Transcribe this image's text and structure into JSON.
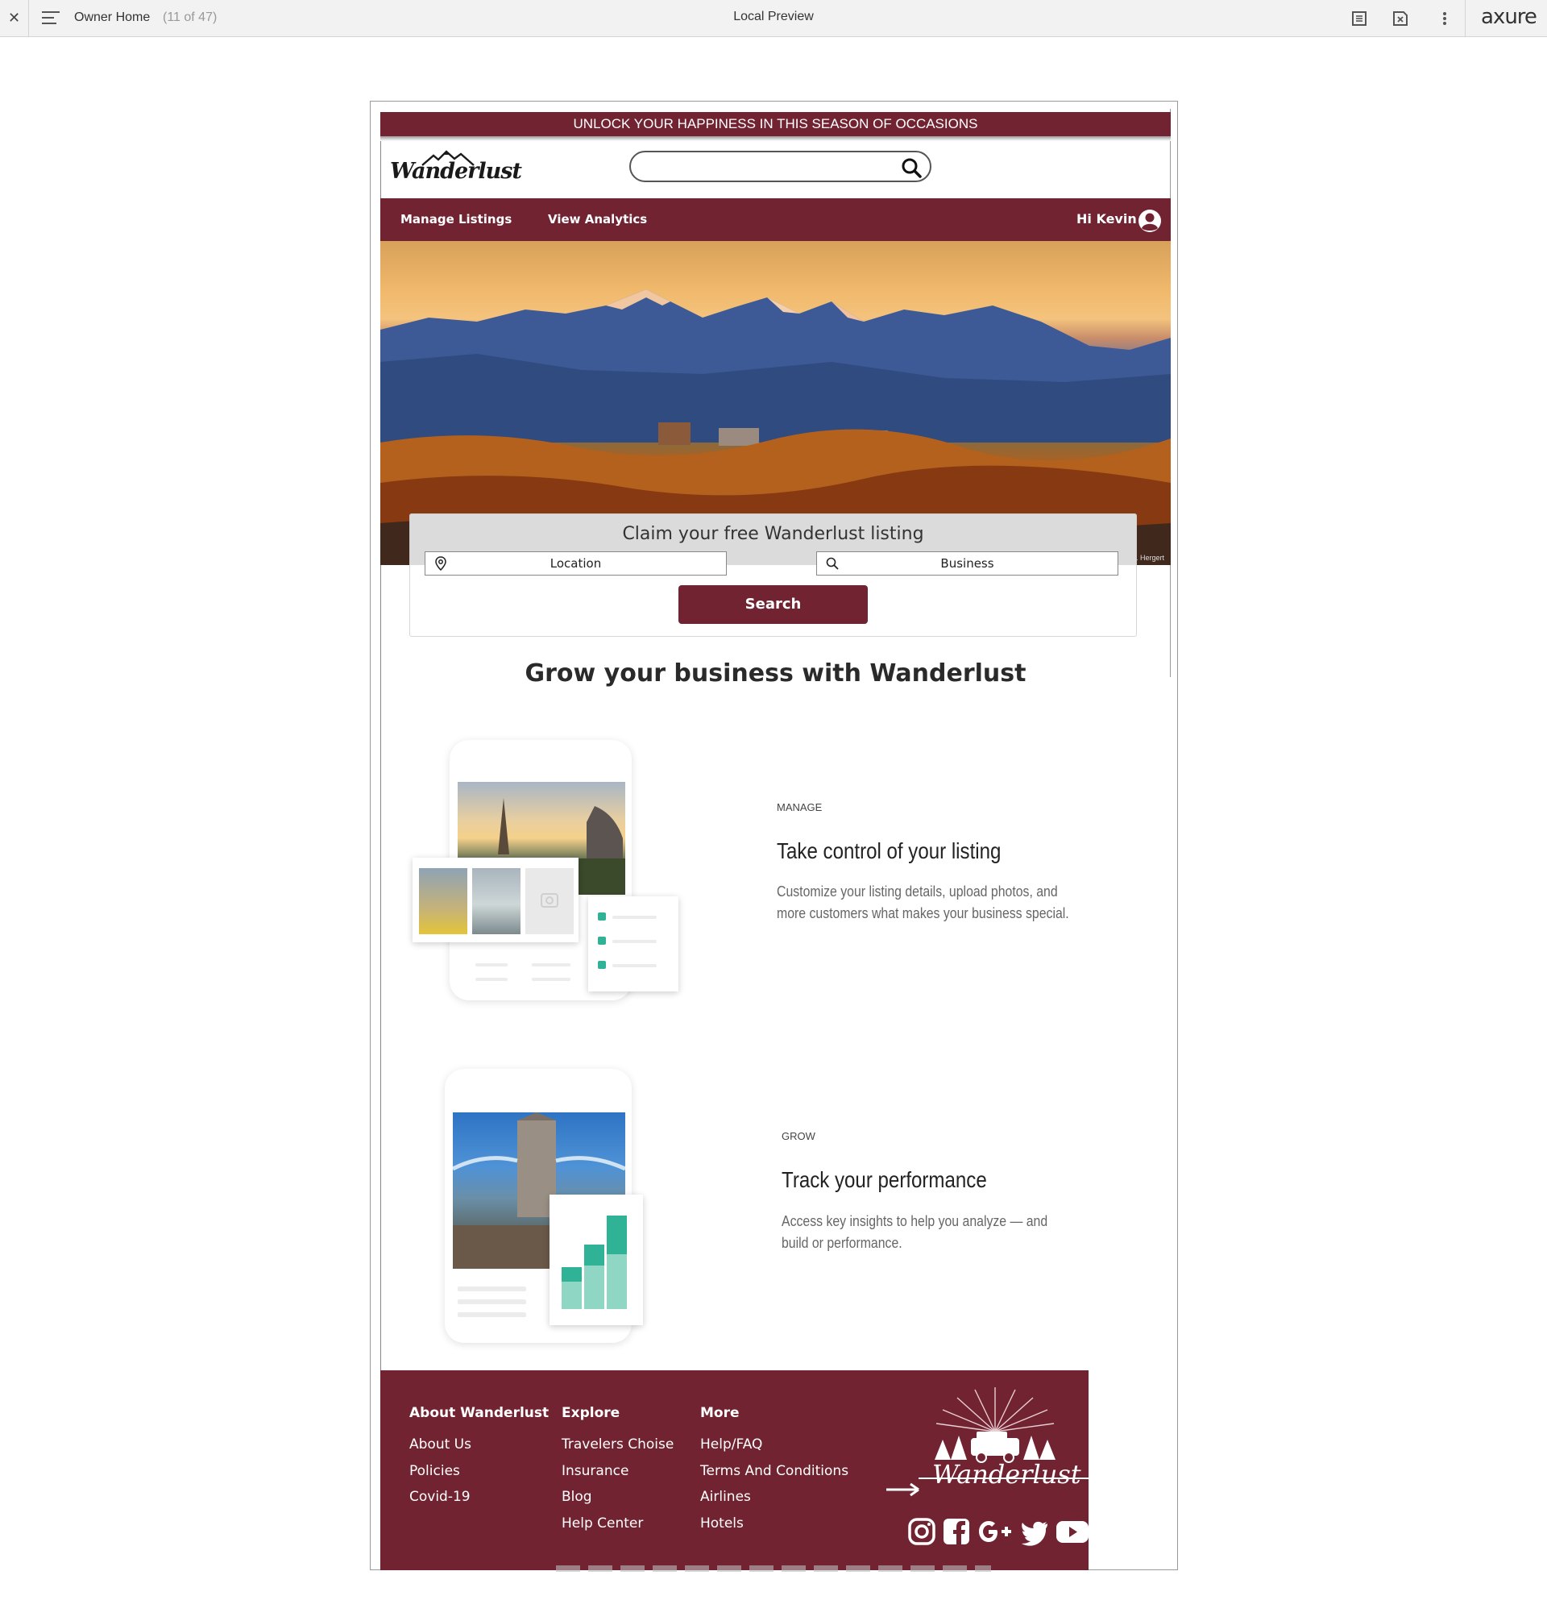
{
  "viewer": {
    "page_name": "Owner Home",
    "page_count": "(11 of 47)",
    "title": "Local Preview",
    "brand": "axure"
  },
  "site": {
    "banner": "UNLOCK YOUR HAPPINESS IN THIS SEASON OF OCCASIONS",
    "logo_text": "Wanderlust",
    "search": {
      "placeholder": "",
      "value": ""
    },
    "nav": {
      "manage_listings": "Manage Listings",
      "view_analytics": "View Analytics",
      "greeting": "Hi Kevin"
    },
    "hero": {
      "credit": "W. Hergert"
    },
    "claim": {
      "title": "Claim your free Wanderlust listing",
      "location_label": "Location",
      "business_label": "Business",
      "search_button": "Search"
    },
    "grow_heading": "Grow your business with Wanderlust",
    "features": [
      {
        "kicker": "MANAGE",
        "title": "Take control of your listing",
        "description": "Customize your listing details, upload photos, and more customers what makes your business special."
      },
      {
        "kicker": "GROW",
        "title": "Track your performance",
        "description": "Access key insights to help you analyze — and build or performance."
      }
    ],
    "footer": {
      "columns": [
        {
          "heading": "About Wanderlust",
          "links": [
            "About Us",
            "Policies",
            "Covid-19"
          ]
        },
        {
          "heading": "Explore",
          "links": [
            "Travelers Choise",
            "Insurance",
            "Blog",
            "Help Center"
          ]
        },
        {
          "heading": "More",
          "links": [
            "Help/FAQ",
            "Terms And Conditions",
            "Airlines",
            "Hotels"
          ]
        }
      ],
      "logo_text": "Wanderlust",
      "social": [
        "instagram-icon",
        "facebook-icon",
        "google-plus-icon",
        "twitter-icon",
        "youtube-icon"
      ]
    }
  },
  "colors": {
    "brand": "#722331",
    "accent_teal": "#2fb295",
    "toolbar_bg": "#f2f2f2"
  }
}
